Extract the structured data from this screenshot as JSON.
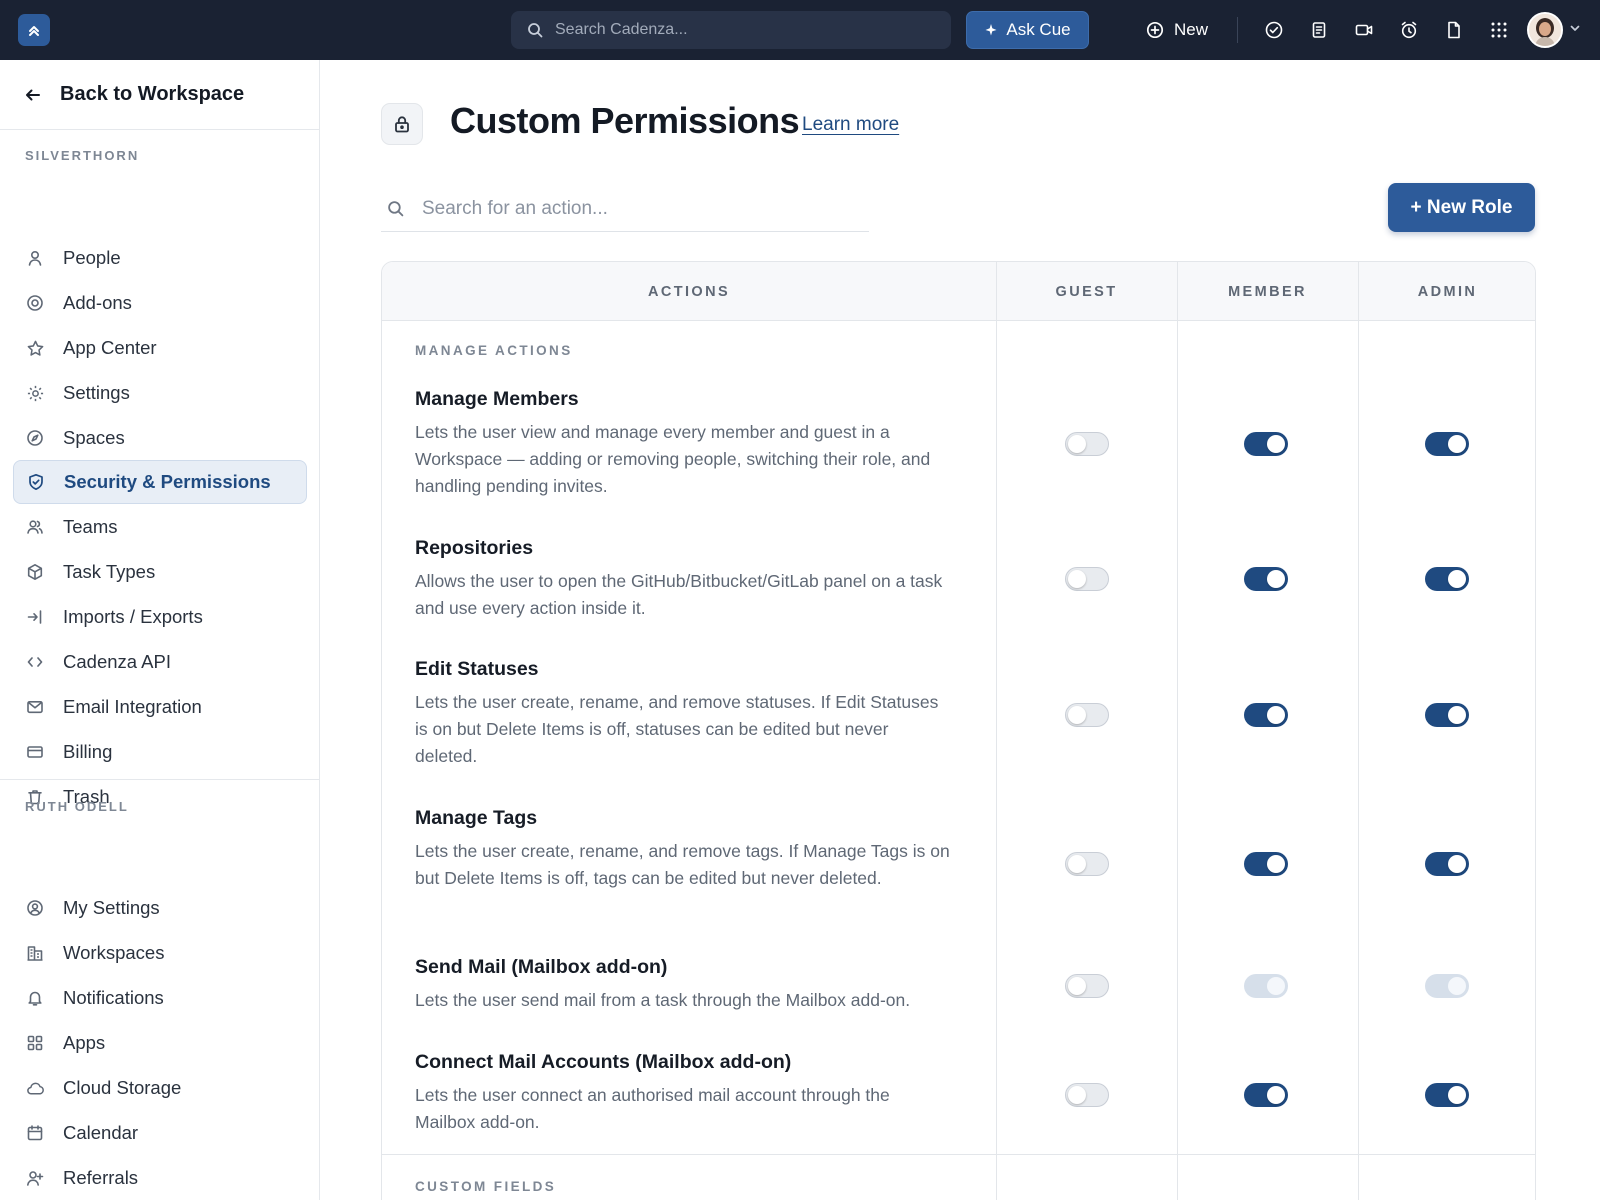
{
  "topbar": {
    "search_placeholder": "Search Cadenza...",
    "ask_label": "Ask Cue",
    "new_label": "New",
    "icons": [
      "check-circle-icon",
      "clipboard-icon",
      "video-icon",
      "alarm-clock-icon",
      "document-icon",
      "apps-grid-icon"
    ]
  },
  "sidebar": {
    "back_label": "Back to Workspace",
    "workspace_section": "SILVERTHORN",
    "workspace_items": [
      {
        "label": "People",
        "icon": "user-icon"
      },
      {
        "label": "Add-ons",
        "icon": "target-icon"
      },
      {
        "label": "App Center",
        "icon": "star-icon"
      },
      {
        "label": "Settings",
        "icon": "gear-icon"
      },
      {
        "label": "Spaces",
        "icon": "compass-icon"
      },
      {
        "label": "Security & Permissions",
        "icon": "shield-icon",
        "active": true
      },
      {
        "label": "Teams",
        "icon": "users-icon"
      },
      {
        "label": "Task Types",
        "icon": "cube-icon"
      },
      {
        "label": "Imports / Exports",
        "icon": "import-icon"
      },
      {
        "label": "Cadenza API",
        "icon": "code-icon"
      },
      {
        "label": "Email Integration",
        "icon": "mail-icon"
      },
      {
        "label": "Billing",
        "icon": "credit-card-icon"
      },
      {
        "label": "Trash",
        "icon": "trash-icon"
      }
    ],
    "user_section": "RUTH ODELL",
    "user_items": [
      {
        "label": "My Settings",
        "icon": "user-circle-icon"
      },
      {
        "label": "Workspaces",
        "icon": "building-icon"
      },
      {
        "label": "Notifications",
        "icon": "bell-icon"
      },
      {
        "label": "Apps",
        "icon": "grid-icon"
      },
      {
        "label": "Cloud Storage",
        "icon": "cloud-icon"
      },
      {
        "label": "Calendar",
        "icon": "calendar-icon"
      },
      {
        "label": "Referrals",
        "icon": "user-plus-icon"
      }
    ]
  },
  "main": {
    "title": "Custom Permissions",
    "learn_more": "Learn more",
    "search_placeholder": "Search for an action...",
    "new_role_label": "+ New Role",
    "columns": [
      "ACTIONS",
      "GUEST",
      "MEMBER",
      "ADMIN"
    ],
    "groups": [
      {
        "label": "MANAGE ACTIONS",
        "rows": [
          {
            "title": "Manage Members",
            "desc": "Lets the user view and manage every member and guest in a Workspace — adding or removing people, switching their role, and handling pending invites.",
            "guest": "off",
            "member": "on",
            "admin": "on"
          },
          {
            "title": "Repositories",
            "desc": "Allows the user to open the GitHub/Bitbucket/GitLab panel on a task and use every action inside it.",
            "guest": "off",
            "member": "on",
            "admin": "on"
          },
          {
            "title": "Edit Statuses",
            "desc": "Lets the user create, rename, and remove statuses. If Edit Statuses is on but Delete Items is off, statuses can be edited but never deleted.",
            "guest": "off",
            "member": "on",
            "admin": "on"
          },
          {
            "title": "Manage Tags",
            "desc": "Lets the user create, rename, and remove tags. If Manage Tags is on but Delete Items is off, tags can be edited but never deleted.",
            "guest": "off",
            "member": "on",
            "admin": "on"
          },
          {
            "title": "Send Mail (Mailbox add-on)",
            "desc": "Lets the user send mail from a task through the Mailbox add-on.",
            "guest": "off",
            "member": "disabled",
            "admin": "disabled"
          },
          {
            "title": "Connect Mail Accounts (Mailbox add-on)",
            "desc": "Lets the user connect an authorised mail account through the Mailbox add-on.",
            "guest": "off",
            "member": "on",
            "admin": "on"
          }
        ]
      },
      {
        "label": "CUSTOM FIELDS",
        "rows": []
      }
    ]
  }
}
